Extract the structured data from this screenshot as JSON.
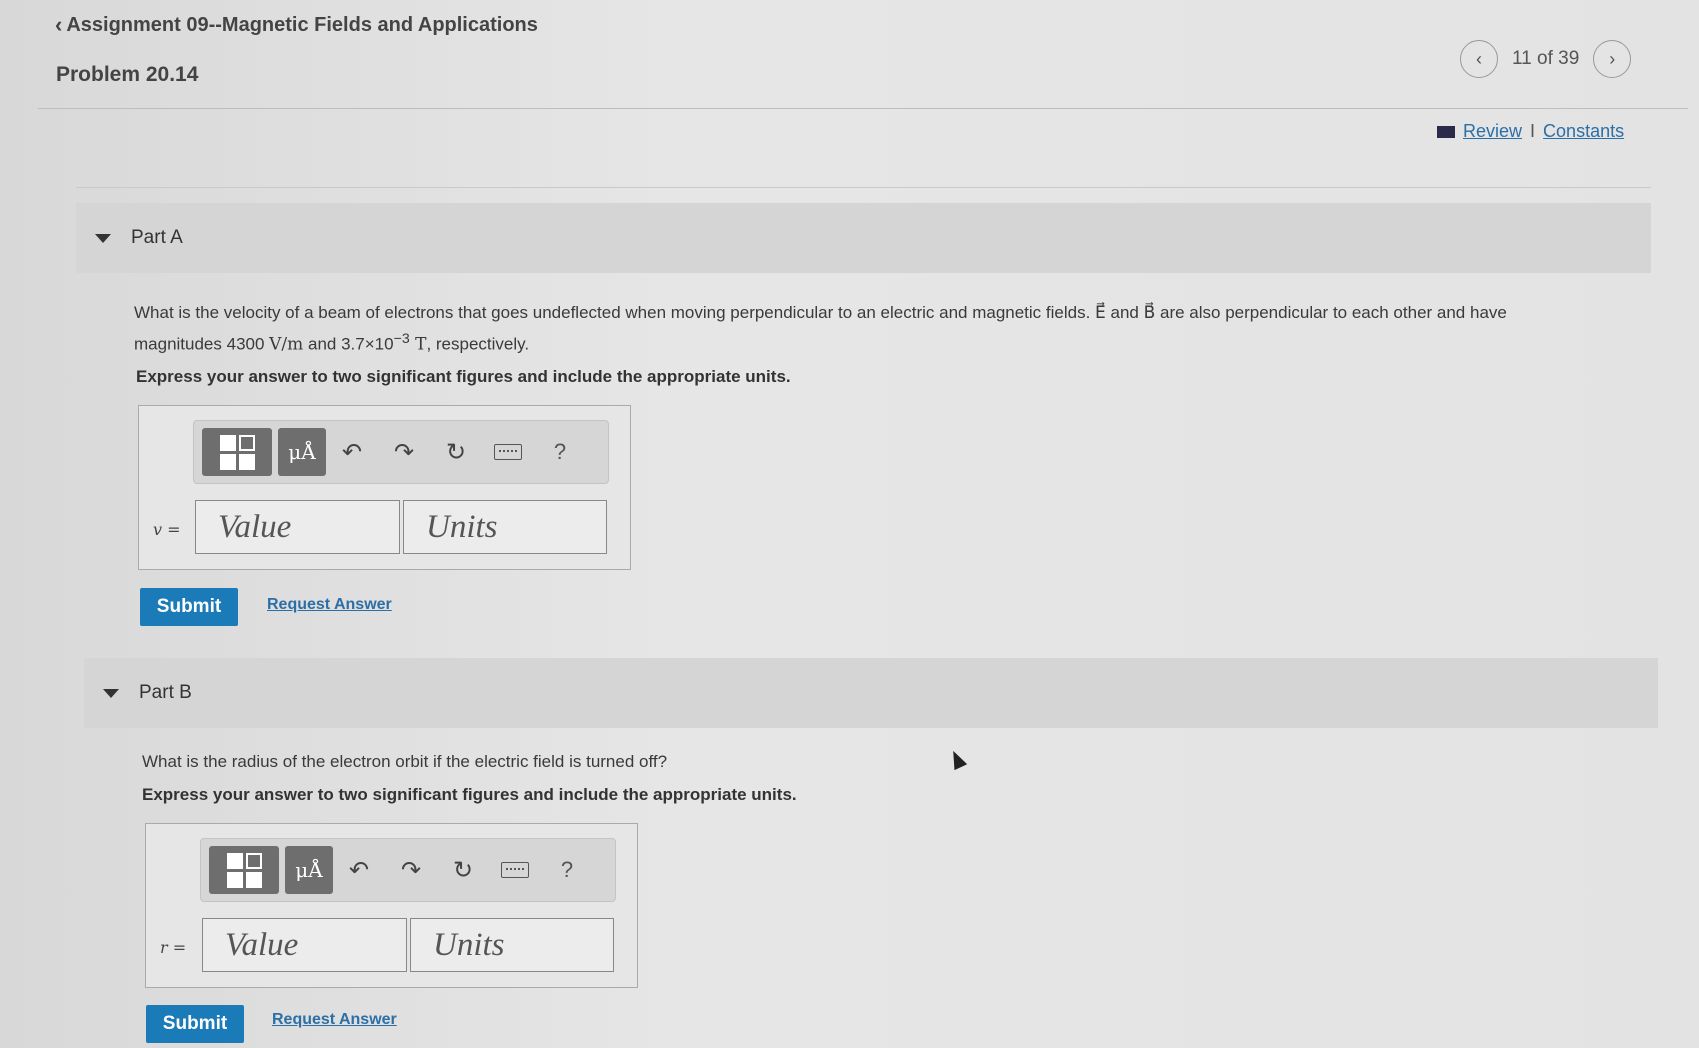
{
  "header": {
    "back_label": "Assignment 09--Magnetic Fields and Applications",
    "problem_title": "Problem 20.14"
  },
  "pager": {
    "prev_icon": "chevron-left-icon",
    "count": "11 of 39",
    "next_icon": "chevron-right-icon"
  },
  "links": {
    "review": "Review",
    "separator": "I",
    "constants": "Constants"
  },
  "toolbar_icons": [
    "templates-icon",
    "units-icon",
    "undo-icon",
    "redo-icon",
    "reset-icon",
    "keyboard-icon",
    "help-icon"
  ],
  "toolbar": {
    "units_glyph": "μÅ",
    "undo_glyph": "↶",
    "redo_glyph": "↷",
    "reset_glyph": "↻",
    "help_glyph": "?"
  },
  "partA": {
    "label": "Part A",
    "question_1": "What is the velocity of a beam of electrons that goes undeflected when moving perpendicular to an electric and magnetic fields. ",
    "E_symbol": "E⃗",
    "and_1": " and ",
    "B_symbol": "B⃗",
    "question_2": " are also perpendicular to each other and have",
    "question_3": "magnitudes 4300 ",
    "unit_1": "V/m",
    "question_4": " and 3.7×10",
    "exponent": "−3",
    "unit_2": " T",
    "question_5": ", respectively.",
    "instruction": "Express your answer to two significant figures and include the appropriate units.",
    "var_label": "v =",
    "value_placeholder": "Value",
    "units_placeholder": "Units",
    "submit": "Submit",
    "request": "Request Answer"
  },
  "partB": {
    "label": "Part B",
    "question": "What is the radius of the electron orbit if the electric field is turned off?",
    "instruction": "Express your answer to two significant figures and include the appropriate units.",
    "var_label": "r =",
    "value_placeholder": "Value",
    "units_placeholder": "Units",
    "submit": "Submit",
    "request": "Request Answer"
  },
  "colors": {
    "accent": "#1a7bb8",
    "link": "#2c6fa6"
  }
}
